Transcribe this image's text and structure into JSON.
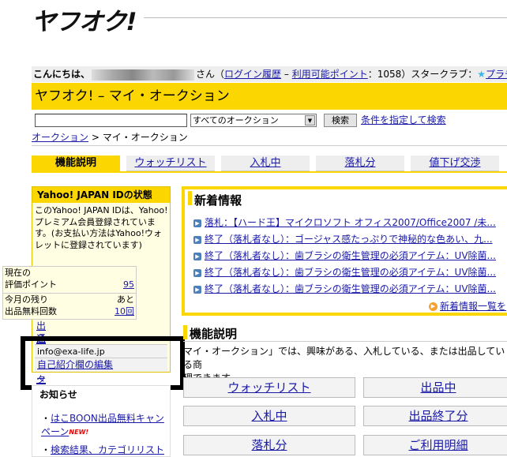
{
  "logo": {
    "text": "ヤフオク!"
  },
  "greeting": {
    "hello": "こんにちは、",
    "suffix": "さん",
    "login_history": "ログイン履歴",
    "dash": " – ",
    "points_label": "利用可能ポイント",
    "points_value": "：1058",
    "star_club": "）スタークラブ：",
    "platinum": "プラチナラン"
  },
  "title": "ヤフオク! – マイ・オークション",
  "search": {
    "placeholder": "",
    "select_value": "すべてのオークション",
    "button": "検索",
    "advanced": "条件を指定して検索"
  },
  "breadcrumb": {
    "root": "オークション",
    "sep": " > ",
    "current": "マイ・オークション"
  },
  "tabs": [
    {
      "label": "機能説明",
      "active": true
    },
    {
      "label": "ウォッチリスト",
      "active": false
    },
    {
      "label": "入札中",
      "active": false
    },
    {
      "label": "落札分",
      "active": false
    },
    {
      "label": "値下げ交渉",
      "active": false
    }
  ],
  "sidebar": {
    "header": "Yahoo! JAPAN IDの状態",
    "text": "このYahoo! JAPAN IDは、Yahoo!プレミアム会員登録されています。(お支払い方法はYahoo!ウォレットに登録されています)",
    "eval_label_1": "現在の",
    "eval_label_2": "評価ポイント",
    "eval_value": "95",
    "listing_label_1": "今月の残り",
    "listing_prefix": "あと",
    "listing_label_2": "出品無料回数",
    "listing_value": "10回",
    "listing_master": "出品マスター",
    "notify_mail": "通知メール設定",
    "email": "info@exa-life.jp",
    "self_intro": "自己紹介欄の編集"
  },
  "notices": {
    "title": "お知らせ",
    "item1": "はこBOON出品無料キャンペーン",
    "new_badge": "NEW!",
    "item2": "検索結果、カテゴリリスト"
  },
  "news": {
    "title": "新着情報",
    "items": [
      "落札：【ハード王】マイクロソフト オフィス2007/Office2007 /未...",
      "終了（落札者なし）：ゴージャス感たっぷりで神秘的な色あい、九...",
      "終了（落札者なし）：歯ブラシの衛生管理の必須アイテム：UV除菌...",
      "終了（落札者なし）：歯ブラシの衛生管理の必須アイテム：UV除菌...",
      "終了（落札者なし）：歯ブラシの衛生管理の必須アイテム：UV除菌..."
    ],
    "more": "新着情報一覧を"
  },
  "features": {
    "title": "機能説明",
    "desc_1": "マイ・オークション」では、興味がある、入札している、または出品している商",
    "desc_2": "理できます。",
    "buttons": [
      "ウォッチリスト",
      "出品中",
      "入札中",
      "出品終了分",
      "落札分",
      "ご利用明細"
    ]
  }
}
